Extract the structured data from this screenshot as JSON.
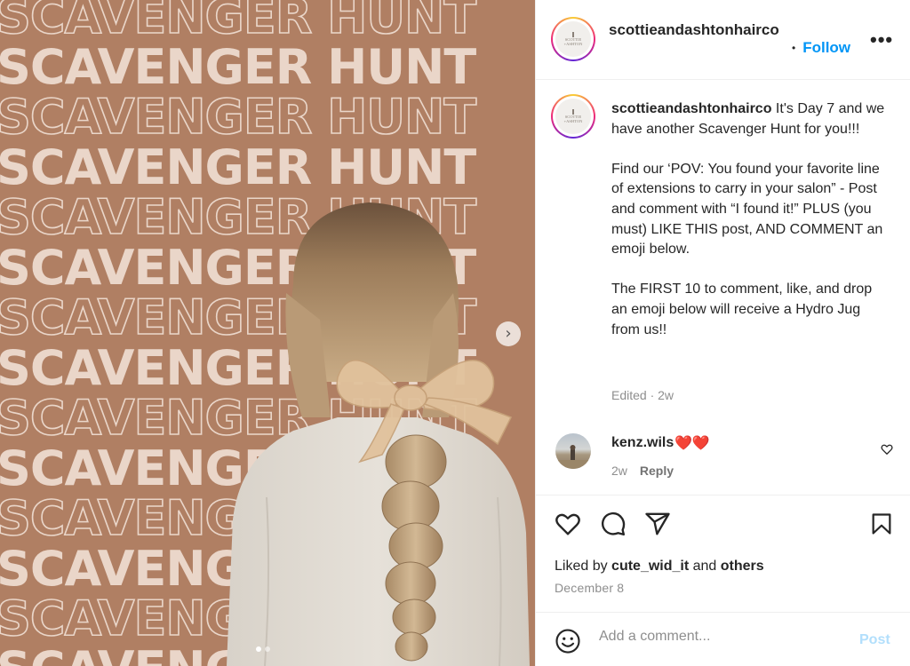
{
  "media": {
    "background_color": "#b07f63",
    "text_color": "#ead6c9",
    "repeated_text": "SCAVENGER HUNT",
    "slide_count": 2,
    "current_slide": 1,
    "next_icon": "chevron-right-icon"
  },
  "header": {
    "username": "scottieandashtonhairco",
    "separator": "•",
    "follow_label": "Follow",
    "more_label": "•••",
    "avatar_brand_line1": "SCOTTIE",
    "avatar_brand_line2": "+ASHTON"
  },
  "caption": {
    "username": "scottieandashtonhairco",
    "text": " It's Day 7 and we have another Scavenger Hunt for you!!!\n\nFind our ‘POV: You found your favorite line of extensions to carry in your salon” - Post and comment with “I found it!” PLUS (you must) LIKE THIS post, AND COMMENT an emoji below.\n\nThe FIRST 10 to comment, like, and drop an emoji below will receive a Hydro Jug from us!!",
    "edited_meta": "Edited · 2w"
  },
  "comments": [
    {
      "username": "kenz.wils",
      "text": "❤️❤️",
      "time": "2w",
      "reply_label": "Reply"
    }
  ],
  "actions": {
    "like_icon": "heart-icon",
    "comment_icon": "comment-icon",
    "share_icon": "send-icon",
    "save_icon": "bookmark-icon"
  },
  "likes": {
    "prefix": "Liked by ",
    "user": "cute_wid_it",
    "middle": " and ",
    "others": "others"
  },
  "post_date": "December 8",
  "add_comment": {
    "placeholder": "Add a comment...",
    "post_label": "Post"
  },
  "colors": {
    "link_blue": "#0095f6",
    "post_disabled": "#b2dffc",
    "muted": "#8e8e8e"
  }
}
